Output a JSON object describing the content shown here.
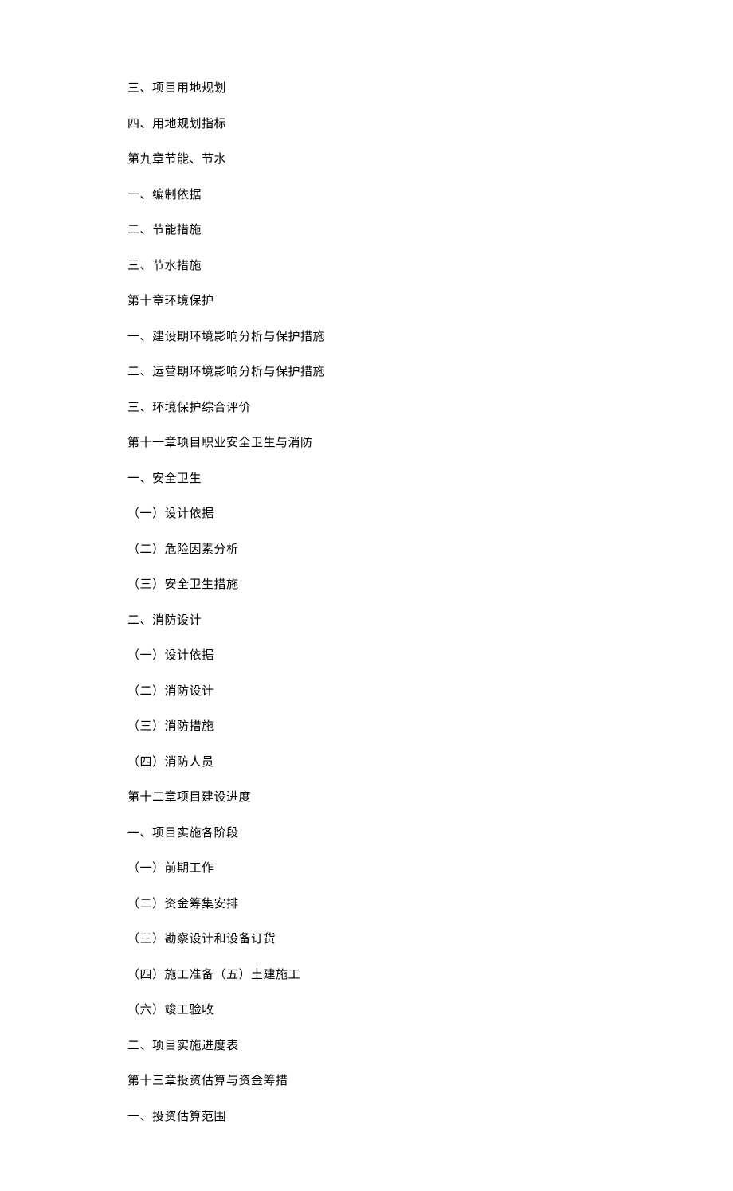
{
  "lines": [
    "三、项目用地规划",
    "四、用地规划指标",
    "第九章节能、节水",
    "一、编制依据",
    "二、节能措施",
    "三、节水措施",
    "第十章环境保护",
    "一、建设期环境影响分析与保护措施",
    "二、运营期环境影响分析与保护措施",
    "三、环境保护综合评价",
    "第十一章项目职业安全卫生与消防",
    "一、安全卫生",
    "（一）设计依据",
    "（二）危险因素分析",
    "（三）安全卫生措施",
    "二、消防设计",
    "（一）设计依据",
    "（二）消防设计",
    "（三）消防措施",
    "（四）消防人员",
    "第十二章项目建设进度",
    "一、项目实施各阶段",
    "（一）前期工作",
    "（二）资金筹集安排",
    "（三）勘察设计和设备订货",
    "（四）施工准备（五）土建施工",
    "（六）竣工验收",
    "二、项目实施进度表",
    "第十三章投资估算与资金筹措",
    "一、投资估算范围"
  ]
}
